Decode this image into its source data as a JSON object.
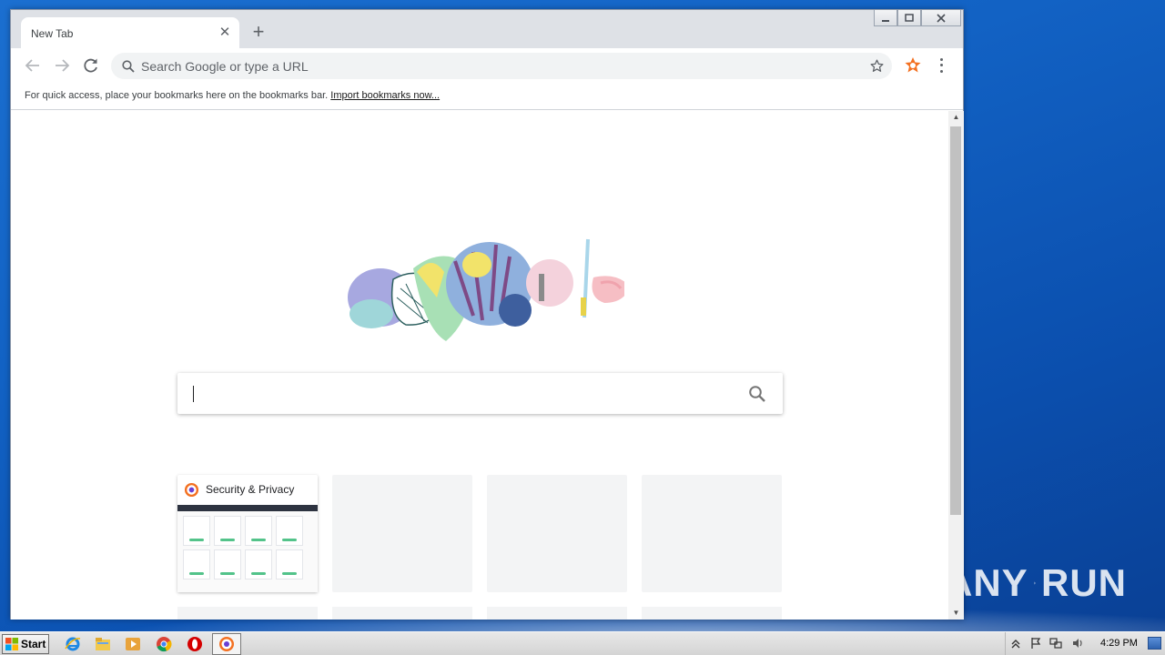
{
  "browser": {
    "tab": {
      "title": "New Tab"
    },
    "omnibox": {
      "placeholder": "Search Google or type a URL"
    },
    "bookmarks_bar": {
      "text": "For quick access, place your bookmarks here on the bookmarks bar.",
      "link": "Import bookmarks now..."
    },
    "ntp": {
      "search_value": "",
      "tiles": [
        {
          "title": "Security & Privacy",
          "filled": true
        },
        {
          "title": "",
          "filled": false
        },
        {
          "title": "",
          "filled": false
        },
        {
          "title": "",
          "filled": false
        }
      ]
    }
  },
  "watermark": {
    "text_left": "ANY",
    "text_right": "RUN"
  },
  "taskbar": {
    "start_label": "Start",
    "clock": "4:29 PM",
    "pinned": [
      "internet-explorer-icon",
      "file-explorer-icon",
      "media-player-icon",
      "chrome-icon",
      "opera-icon",
      "avast-browser-icon"
    ]
  },
  "colors": {
    "accent": "#1a73e8",
    "desktop": "#1262c4",
    "ext_orange": "#f37021"
  }
}
